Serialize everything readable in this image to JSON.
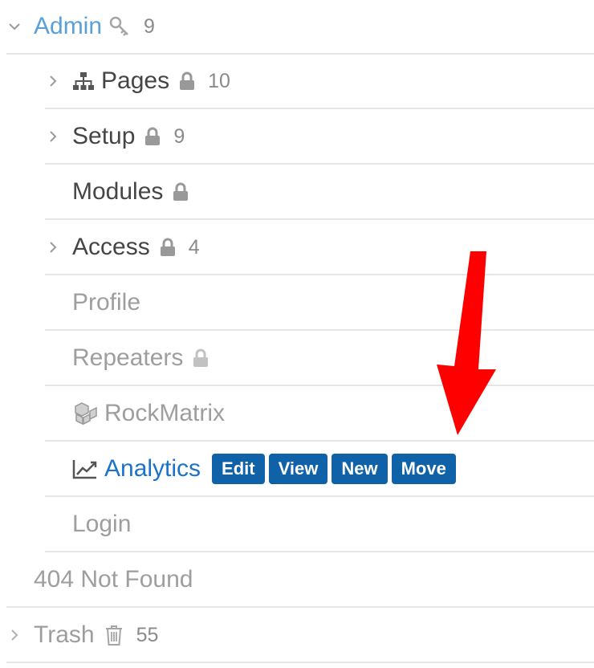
{
  "tree": {
    "admin": {
      "label": "Admin",
      "count": "9"
    },
    "children": {
      "pages": {
        "label": "Pages",
        "count": "10"
      },
      "setup": {
        "label": "Setup",
        "count": "9"
      },
      "modules": {
        "label": "Modules"
      },
      "access": {
        "label": "Access",
        "count": "4"
      },
      "profile": {
        "label": "Profile"
      },
      "repeaters": {
        "label": "Repeaters"
      },
      "rockmatrix": {
        "label": "RockMatrix"
      },
      "analytics": {
        "label": "Analytics",
        "actions": {
          "edit": "Edit",
          "view": "View",
          "new": "New",
          "move": "Move"
        }
      },
      "login": {
        "label": "Login"
      }
    },
    "not_found": {
      "label": "404 Not Found"
    },
    "trash": {
      "label": "Trash",
      "count": "55"
    }
  },
  "icons": {
    "admin": "key-icon",
    "pages": "sitemap-icon",
    "locked": "lock-icon",
    "rockmatrix": "cubes-icon",
    "analytics": "line-chart-icon",
    "trash": "trash-icon",
    "annotation": "red-arrow-down"
  },
  "colors": {
    "link_blue": "#1a73c8",
    "admin_blue": "#5aa0d8",
    "button_blue": "#0f61a8",
    "arrow_red": "#ff0000",
    "text_dark": "#454545",
    "text_light": "#9e9e9e"
  }
}
